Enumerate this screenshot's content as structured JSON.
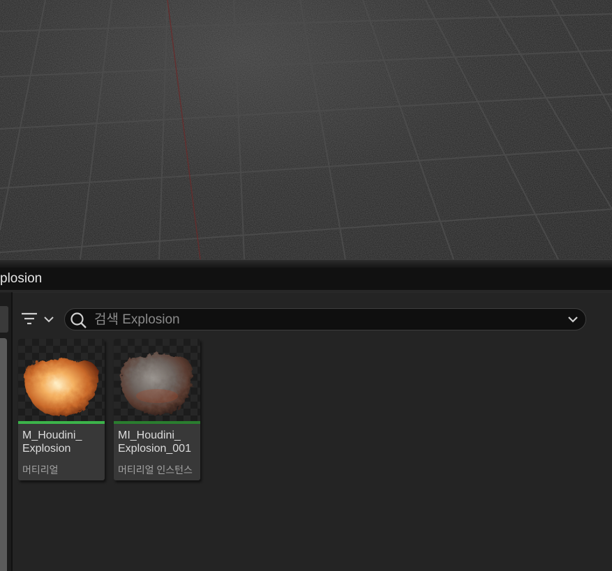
{
  "content_browser": {
    "path_label": "plosion",
    "filter": {
      "icon": "filter-icon",
      "dropdown_icon": "chevron-down-icon"
    },
    "search": {
      "icon": "search-icon",
      "value": "",
      "placeholder": "검색 Explosion",
      "dropdown_icon": "chevron-down-icon"
    },
    "assets": [
      {
        "name": "M_Houdini_\nExplosion",
        "type": "머티리얼",
        "type_color": "#3cb34a"
      },
      {
        "name": "MI_Houdini_\nExplosion_001",
        "type": "머티리얼 인스턴스",
        "type_color": "#2a7d2f"
      }
    ]
  }
}
